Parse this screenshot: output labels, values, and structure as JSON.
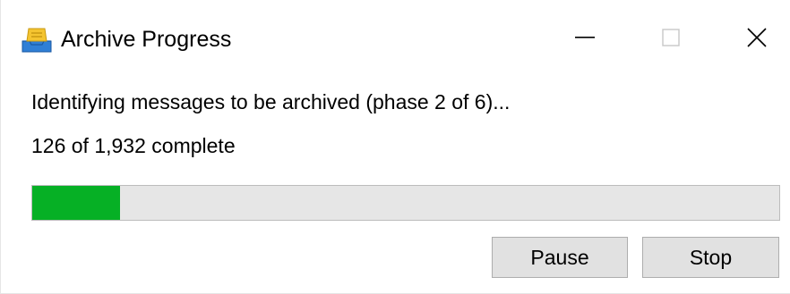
{
  "window": {
    "title": "Archive Progress",
    "app_icon": "archive-icon"
  },
  "controls": {
    "minimize_icon": "minimize-icon",
    "maximize_icon": "maximize-icon",
    "close_icon": "close-icon",
    "maximize_disabled": true
  },
  "status": {
    "phase_text": "Identifying messages to be archived (phase 2 of 6)...",
    "count_text": "126 of 1,932 complete"
  },
  "progress": {
    "completed": 126,
    "total": 1932,
    "bar_fraction": 0.117,
    "fill_color": "#06b025",
    "track_color": "#e6e6e6"
  },
  "buttons": {
    "pause_label": "Pause",
    "stop_label": "Stop"
  }
}
